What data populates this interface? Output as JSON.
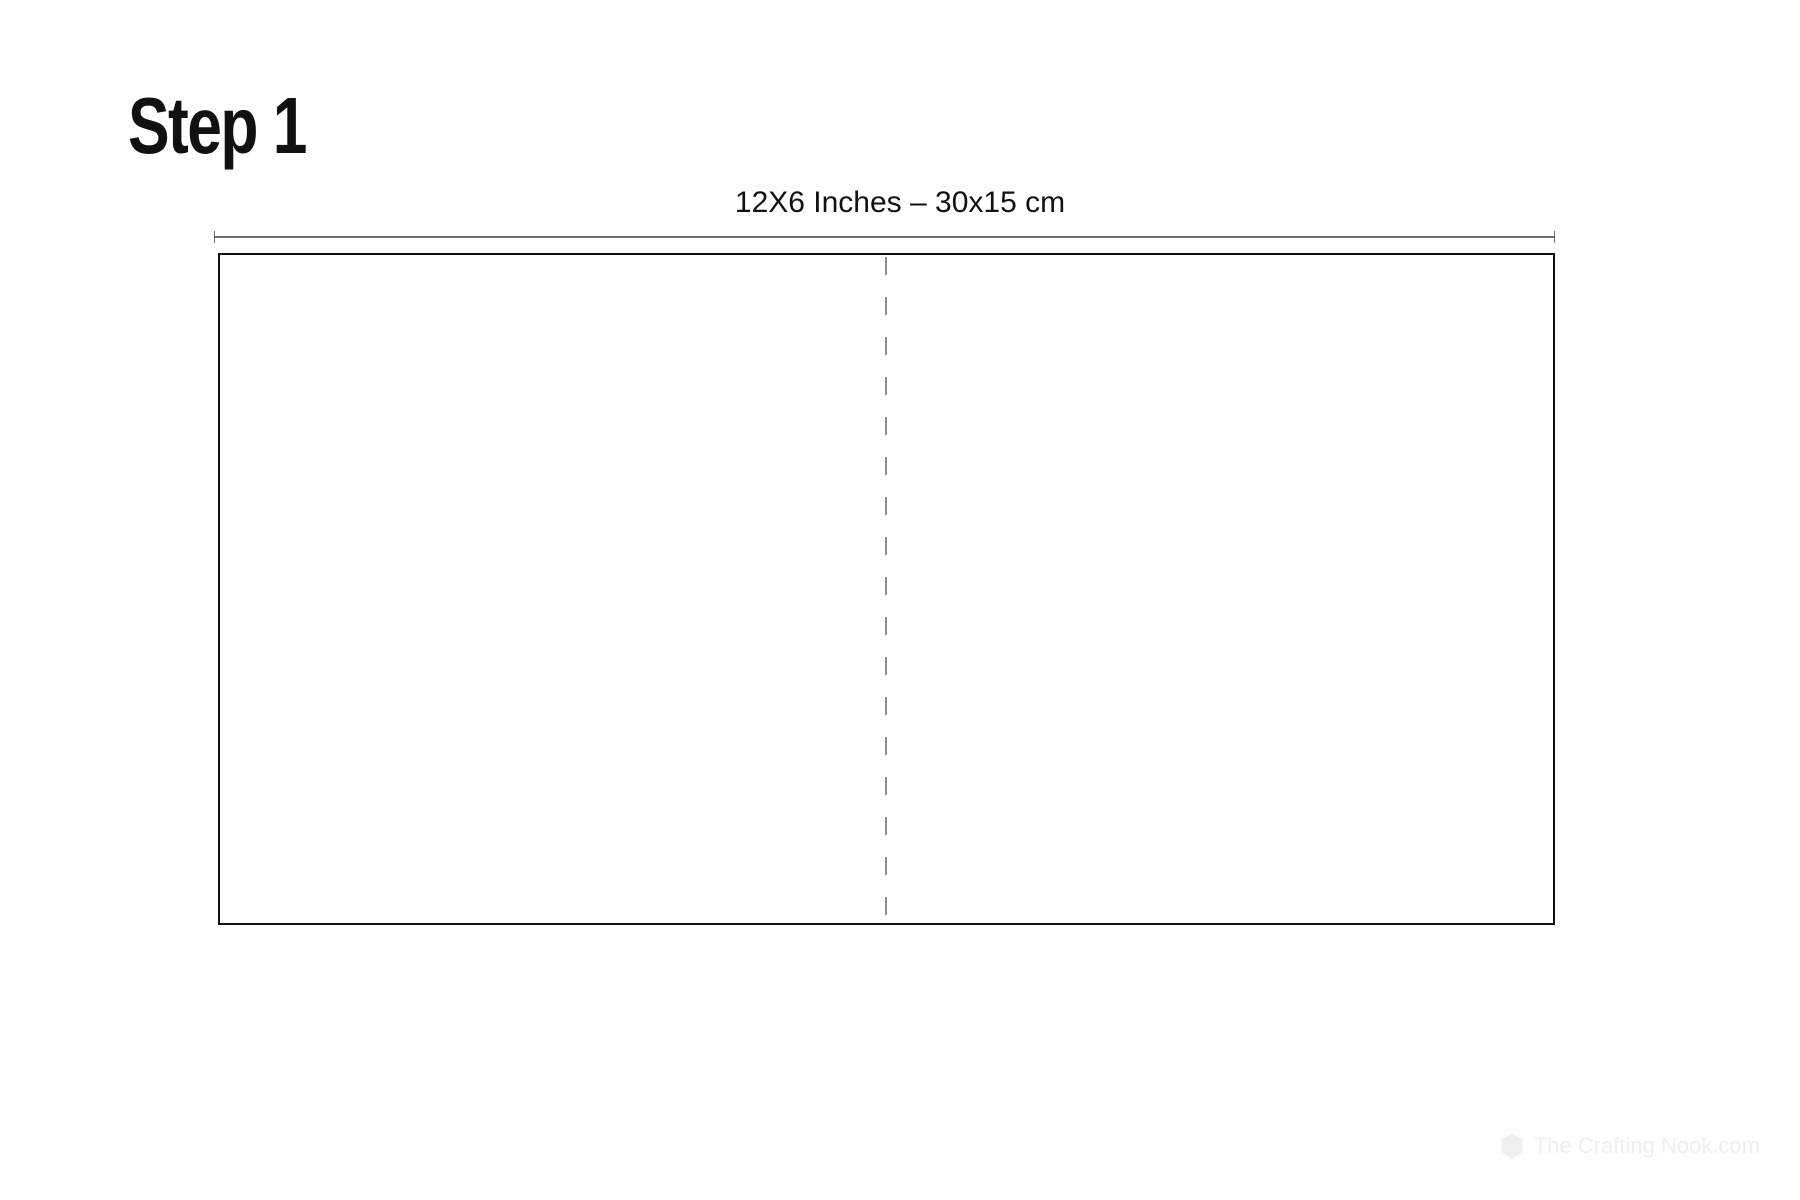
{
  "step": {
    "title": "Step 1"
  },
  "dimension": {
    "label": "12X6 Inches – 30x15 cm"
  },
  "diagram": {
    "width_inches": 12,
    "height_inches": 6,
    "width_cm": 30,
    "height_cm": 15,
    "fold_position": "center"
  },
  "watermark": {
    "text": "The Crafting Nook.com"
  }
}
